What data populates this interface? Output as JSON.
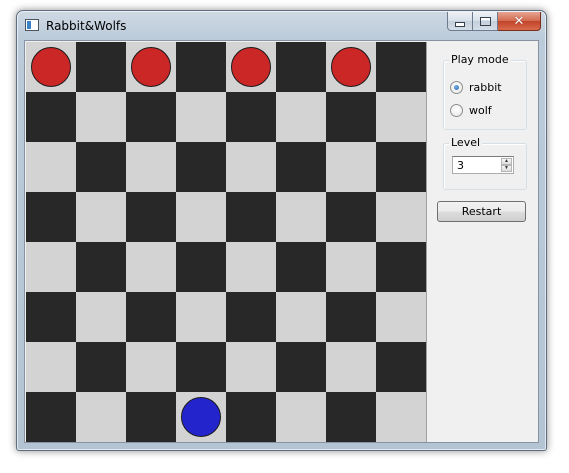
{
  "window": {
    "title": "Rabbit&Wolfs",
    "icon": "app-window-icon",
    "controls": {
      "minimize": "minimize-icon",
      "maximize": "maximize-icon",
      "close": "close-icon"
    }
  },
  "board": {
    "rows": 8,
    "cols": 8,
    "colors": {
      "dark": "#282828",
      "light": "#d3d3d3"
    },
    "pieces": [
      {
        "type": "wolf",
        "row": 0,
        "col": 0,
        "color": "#cc2727"
      },
      {
        "type": "wolf",
        "row": 0,
        "col": 2,
        "color": "#cc2727"
      },
      {
        "type": "wolf",
        "row": 0,
        "col": 4,
        "color": "#cc2727"
      },
      {
        "type": "wolf",
        "row": 0,
        "col": 6,
        "color": "#cc2727"
      },
      {
        "type": "rabbit",
        "row": 7,
        "col": 3,
        "color": "#2424cc"
      }
    ]
  },
  "play_mode": {
    "title": "Play mode",
    "options": [
      {
        "label": "rabbit",
        "checked": true
      },
      {
        "label": "wolf",
        "checked": false
      }
    ]
  },
  "level": {
    "title": "Level",
    "value": "3"
  },
  "restart_label": "Restart"
}
